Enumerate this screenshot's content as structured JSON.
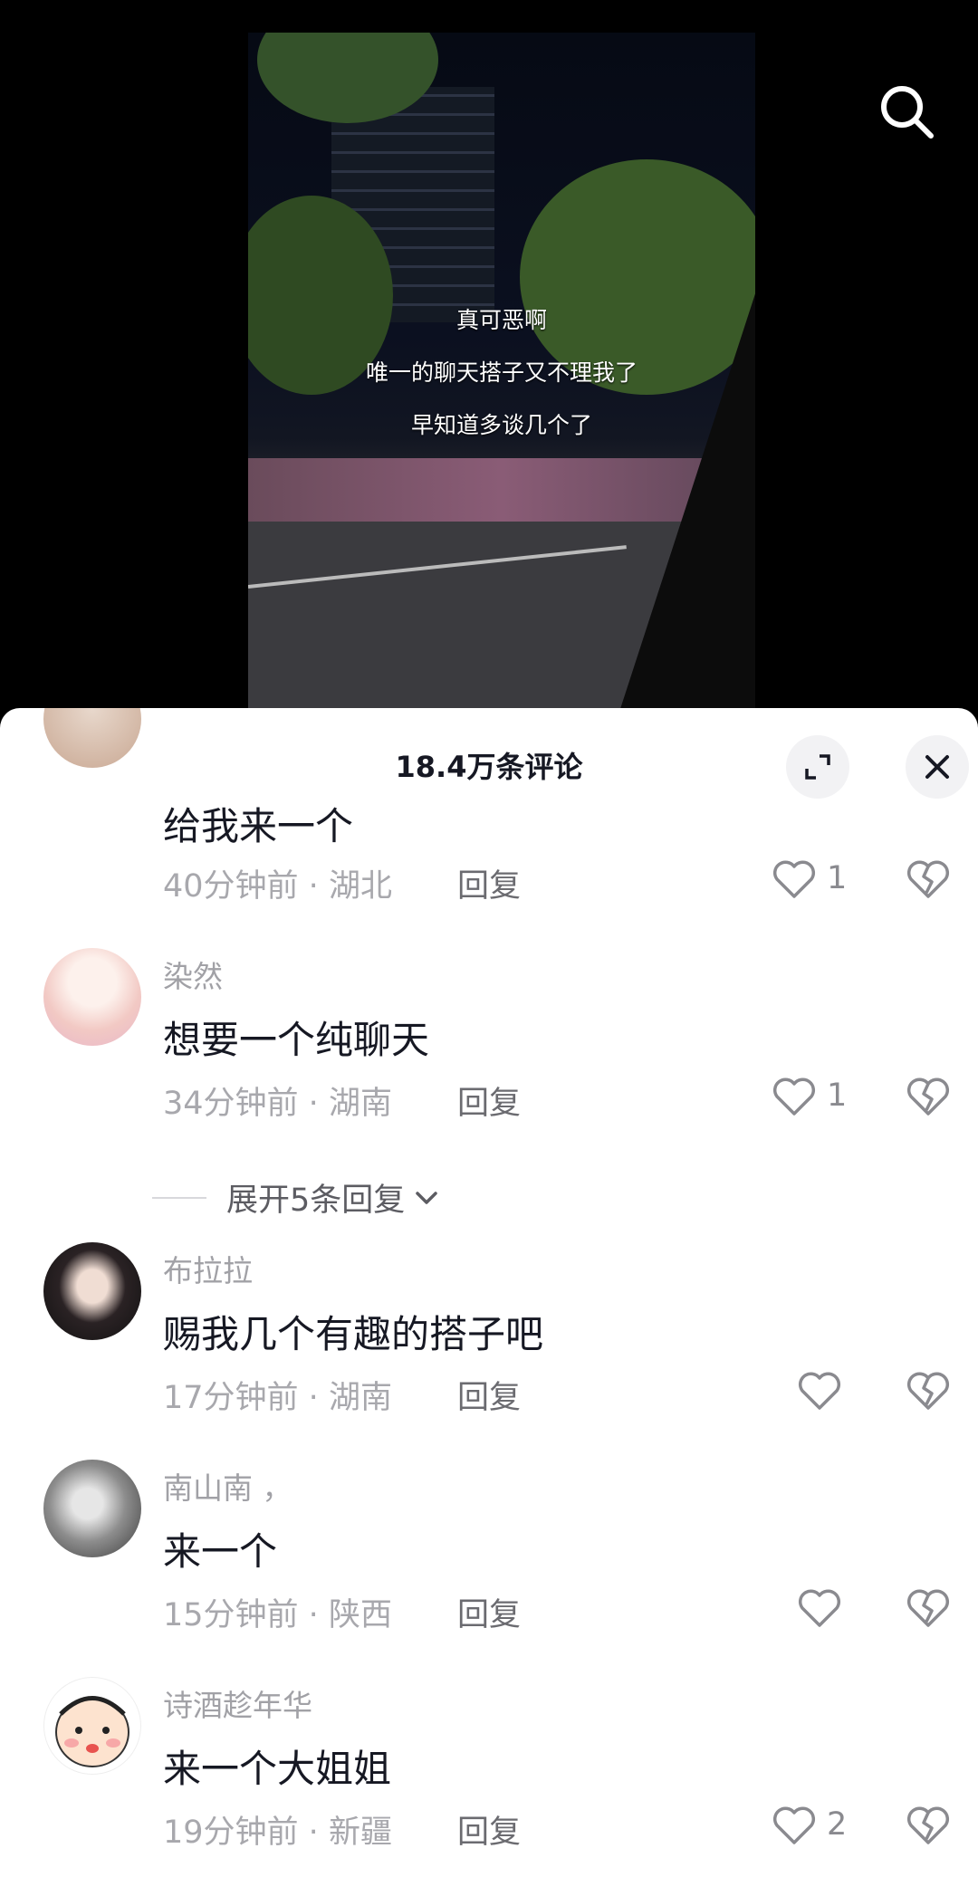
{
  "video": {
    "caption_lines": [
      "真可恶啊",
      "唯一的聊天搭子又不理我了",
      "早知道多谈几个了"
    ]
  },
  "comments_sheet": {
    "title": "18.4万条评论",
    "reply_label": "回复",
    "expand_label": "展开5条回复",
    "comments": [
      {
        "username": "",
        "text": "给我来一个",
        "time": "40分钟前",
        "region": "湖北",
        "likes": "1"
      },
      {
        "username": "染然",
        "text": "想要一个纯聊天",
        "time": "34分钟前",
        "region": "湖南",
        "likes": "1"
      },
      {
        "username": "布拉拉",
        "text": "赐我几个有趣的搭子吧",
        "time": "17分钟前",
        "region": "湖南",
        "likes": ""
      },
      {
        "username": "南山南 ，",
        "text": "来一个",
        "time": "15分钟前",
        "region": "陕西",
        "likes": ""
      },
      {
        "username": "诗酒趁年华",
        "text": "来一个大姐姐",
        "time": "19分钟前",
        "region": "新疆",
        "likes": "2"
      }
    ]
  },
  "icons": [
    "search-icon",
    "expand-icon",
    "close-icon",
    "heart-icon",
    "broken-heart-icon",
    "chevron-down-icon"
  ],
  "colors": {
    "text_primary": "#161823",
    "text_secondary": "#a8a8ad",
    "sheet_bg": "#ffffff"
  }
}
